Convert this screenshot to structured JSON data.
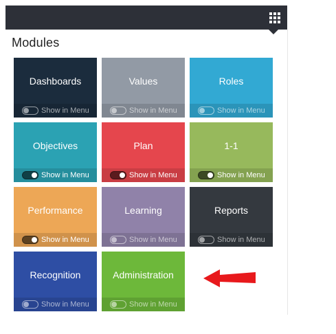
{
  "header": {
    "apps_icon": "grid-icon",
    "bar_color": "#2d3038"
  },
  "modules": {
    "title": "Modules",
    "items": [
      {
        "name": "Dashboards",
        "color": "#1b2c3d",
        "show_in_menu": false,
        "toggle_label": "Show in Menu"
      },
      {
        "name": "Values",
        "color": "#929aa5",
        "show_in_menu": false,
        "toggle_label": "Show in Menu"
      },
      {
        "name": "Roles",
        "color": "#32a9d3",
        "show_in_menu": false,
        "toggle_label": "Show in Menu"
      },
      {
        "name": "Objectives",
        "color": "#2ba2b3",
        "show_in_menu": true,
        "toggle_label": "Show in Menu"
      },
      {
        "name": "Plan",
        "color": "#e5464d",
        "show_in_menu": true,
        "toggle_label": "Show in Menu"
      },
      {
        "name": "1-1",
        "color": "#97b95c",
        "show_in_menu": true,
        "toggle_label": "Show in Menu"
      },
      {
        "name": "Performance",
        "color": "#eda756",
        "show_in_menu": true,
        "toggle_label": "Show in Menu"
      },
      {
        "name": "Learning",
        "color": "#9082a9",
        "show_in_menu": false,
        "toggle_label": "Show in Menu"
      },
      {
        "name": "Reports",
        "color": "#34393f",
        "show_in_menu": false,
        "toggle_label": "Show in Menu"
      },
      {
        "name": "Recognition",
        "color": "#2e4ea4",
        "show_in_menu": false,
        "toggle_label": "Show in Menu"
      },
      {
        "name": "Administration",
        "color": "#6db83a",
        "show_in_menu": false,
        "toggle_label": "Show in Menu"
      }
    ]
  },
  "annotation": {
    "icon": "red-arrow-icon",
    "color": "#e8191c"
  }
}
